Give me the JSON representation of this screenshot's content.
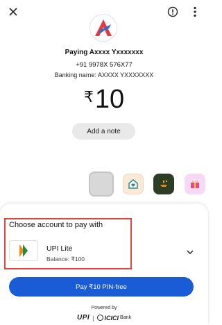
{
  "header": {
    "icons": [
      "close-icon",
      "alert-circle-icon",
      "more-vert-icon"
    ]
  },
  "payee": {
    "name": "Paying Axxxx Yxxxxxxx",
    "phone": "+91 9978X 576X77",
    "banking_name_label": "Banking name: ",
    "banking_name": "AXXXX YXXXXXXX"
  },
  "amount": {
    "currency": "₹",
    "value": "10"
  },
  "note_button": "Add a note",
  "themes": [
    "default",
    "home",
    "lamp",
    "gift"
  ],
  "payment_sheet": {
    "title": "Choose account to pay with",
    "account": {
      "name": "UPI Lite",
      "balance": "Balance: ₹100"
    },
    "pay_button": "Pay ₹10 PIN-free"
  },
  "footer": {
    "powered_by": "Powered by",
    "upi": "UPI",
    "separator": "|",
    "bank": "ICICI",
    "bank_suffix": "Bank"
  },
  "colors": {
    "primary": "#1a5bd6",
    "highlight": "#e0443c",
    "note_bg": "#e9e9e9"
  }
}
